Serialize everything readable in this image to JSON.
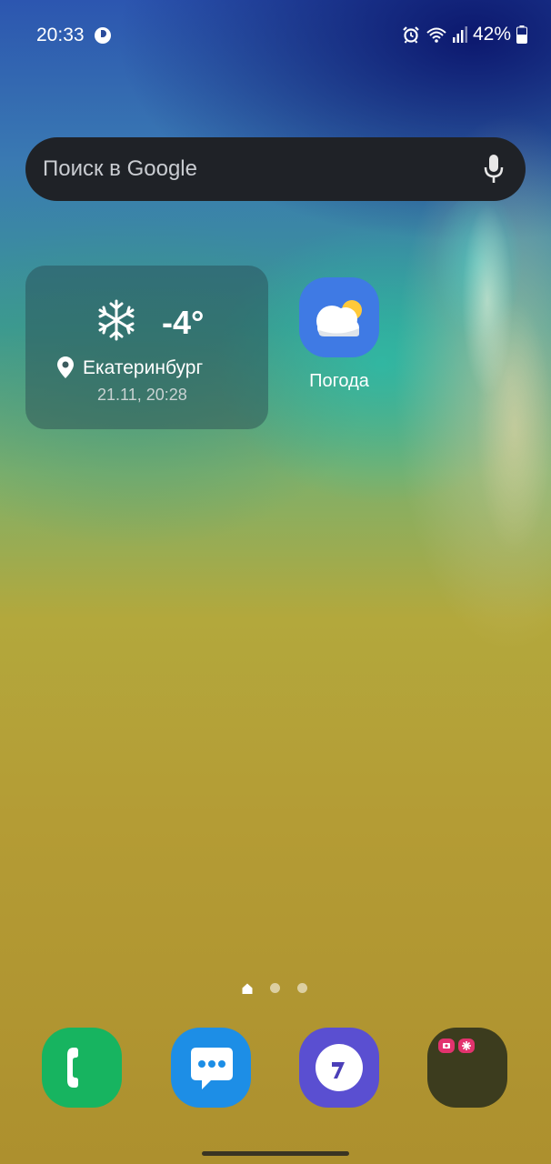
{
  "status_bar": {
    "time": "20:33",
    "battery_percent": "42%",
    "icons": [
      "app-notification-icon",
      "alarm-icon",
      "wifi-icon",
      "signal-icon",
      "battery-icon"
    ]
  },
  "search": {
    "placeholder": "Поиск в Google",
    "icon": "mic-icon"
  },
  "weather_widget": {
    "condition_icon": "snowflake-icon",
    "temperature": "-4°",
    "city": "Екатеринбург",
    "updated": "21.11, 20:28"
  },
  "apps": {
    "weather_label": "Погода"
  },
  "page_indicator": {
    "pages": 3,
    "current": 1
  },
  "dock": {
    "apps": [
      "phone",
      "messages",
      "internet",
      "folder"
    ]
  },
  "colors": {
    "search_bg": "#1f2227",
    "weather_app_bg": "#3f7ae4",
    "phone_bg": "#17b460",
    "messages_bg": "#1d8ee6",
    "internet_bg": "#5a4fd1",
    "folder_bg": "#3c3c1e"
  }
}
